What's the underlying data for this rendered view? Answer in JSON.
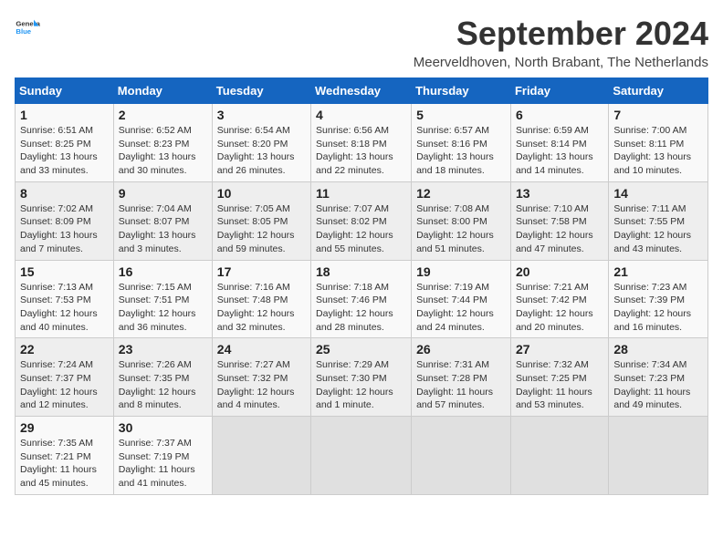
{
  "header": {
    "logo_general": "General",
    "logo_blue": "Blue",
    "month_title": "September 2024",
    "location": "Meerveldhoven, North Brabant, The Netherlands"
  },
  "calendar": {
    "days_of_week": [
      "Sunday",
      "Monday",
      "Tuesday",
      "Wednesday",
      "Thursday",
      "Friday",
      "Saturday"
    ],
    "weeks": [
      [
        {
          "day": "",
          "info": ""
        },
        {
          "day": "2",
          "info": "Sunrise: 6:52 AM\nSunset: 8:23 PM\nDaylight: 13 hours\nand 30 minutes."
        },
        {
          "day": "3",
          "info": "Sunrise: 6:54 AM\nSunset: 8:20 PM\nDaylight: 13 hours\nand 26 minutes."
        },
        {
          "day": "4",
          "info": "Sunrise: 6:56 AM\nSunset: 8:18 PM\nDaylight: 13 hours\nand 22 minutes."
        },
        {
          "day": "5",
          "info": "Sunrise: 6:57 AM\nSunset: 8:16 PM\nDaylight: 13 hours\nand 18 minutes."
        },
        {
          "day": "6",
          "info": "Sunrise: 6:59 AM\nSunset: 8:14 PM\nDaylight: 13 hours\nand 14 minutes."
        },
        {
          "day": "7",
          "info": "Sunrise: 7:00 AM\nSunset: 8:11 PM\nDaylight: 13 hours\nand 10 minutes."
        }
      ],
      [
        {
          "day": "1",
          "info": "Sunrise: 6:51 AM\nSunset: 8:25 PM\nDaylight: 13 hours\nand 33 minutes."
        },
        {
          "day": "9",
          "info": "Sunrise: 7:04 AM\nSunset: 8:07 PM\nDaylight: 13 hours\nand 3 minutes."
        },
        {
          "day": "10",
          "info": "Sunrise: 7:05 AM\nSunset: 8:05 PM\nDaylight: 12 hours\nand 59 minutes."
        },
        {
          "day": "11",
          "info": "Sunrise: 7:07 AM\nSunset: 8:02 PM\nDaylight: 12 hours\nand 55 minutes."
        },
        {
          "day": "12",
          "info": "Sunrise: 7:08 AM\nSunset: 8:00 PM\nDaylight: 12 hours\nand 51 minutes."
        },
        {
          "day": "13",
          "info": "Sunrise: 7:10 AM\nSunset: 7:58 PM\nDaylight: 12 hours\nand 47 minutes."
        },
        {
          "day": "14",
          "info": "Sunrise: 7:11 AM\nSunset: 7:55 PM\nDaylight: 12 hours\nand 43 minutes."
        }
      ],
      [
        {
          "day": "8",
          "info": "Sunrise: 7:02 AM\nSunset: 8:09 PM\nDaylight: 13 hours\nand 7 minutes."
        },
        {
          "day": "16",
          "info": "Sunrise: 7:15 AM\nSunset: 7:51 PM\nDaylight: 12 hours\nand 36 minutes."
        },
        {
          "day": "17",
          "info": "Sunrise: 7:16 AM\nSunset: 7:48 PM\nDaylight: 12 hours\nand 32 minutes."
        },
        {
          "day": "18",
          "info": "Sunrise: 7:18 AM\nSunset: 7:46 PM\nDaylight: 12 hours\nand 28 minutes."
        },
        {
          "day": "19",
          "info": "Sunrise: 7:19 AM\nSunset: 7:44 PM\nDaylight: 12 hours\nand 24 minutes."
        },
        {
          "day": "20",
          "info": "Sunrise: 7:21 AM\nSunset: 7:42 PM\nDaylight: 12 hours\nand 20 minutes."
        },
        {
          "day": "21",
          "info": "Sunrise: 7:23 AM\nSunset: 7:39 PM\nDaylight: 12 hours\nand 16 minutes."
        }
      ],
      [
        {
          "day": "15",
          "info": "Sunrise: 7:13 AM\nSunset: 7:53 PM\nDaylight: 12 hours\nand 40 minutes."
        },
        {
          "day": "23",
          "info": "Sunrise: 7:26 AM\nSunset: 7:35 PM\nDaylight: 12 hours\nand 8 minutes."
        },
        {
          "day": "24",
          "info": "Sunrise: 7:27 AM\nSunset: 7:32 PM\nDaylight: 12 hours\nand 4 minutes."
        },
        {
          "day": "25",
          "info": "Sunrise: 7:29 AM\nSunset: 7:30 PM\nDaylight: 12 hours\nand 1 minute."
        },
        {
          "day": "26",
          "info": "Sunrise: 7:31 AM\nSunset: 7:28 PM\nDaylight: 11 hours\nand 57 minutes."
        },
        {
          "day": "27",
          "info": "Sunrise: 7:32 AM\nSunset: 7:25 PM\nDaylight: 11 hours\nand 53 minutes."
        },
        {
          "day": "28",
          "info": "Sunrise: 7:34 AM\nSunset: 7:23 PM\nDaylight: 11 hours\nand 49 minutes."
        }
      ],
      [
        {
          "day": "22",
          "info": "Sunrise: 7:24 AM\nSunset: 7:37 PM\nDaylight: 12 hours\nand 12 minutes."
        },
        {
          "day": "30",
          "info": "Sunrise: 7:37 AM\nSunset: 7:19 PM\nDaylight: 11 hours\nand 41 minutes."
        },
        {
          "day": "",
          "info": ""
        },
        {
          "day": "",
          "info": ""
        },
        {
          "day": "",
          "info": ""
        },
        {
          "day": "",
          "info": ""
        },
        {
          "day": "",
          "info": ""
        }
      ],
      [
        {
          "day": "29",
          "info": "Sunrise: 7:35 AM\nSunset: 7:21 PM\nDaylight: 11 hours\nand 45 minutes."
        },
        {
          "day": "",
          "info": ""
        },
        {
          "day": "",
          "info": ""
        },
        {
          "day": "",
          "info": ""
        },
        {
          "day": "",
          "info": ""
        },
        {
          "day": "",
          "info": ""
        },
        {
          "day": "",
          "info": ""
        }
      ]
    ]
  }
}
